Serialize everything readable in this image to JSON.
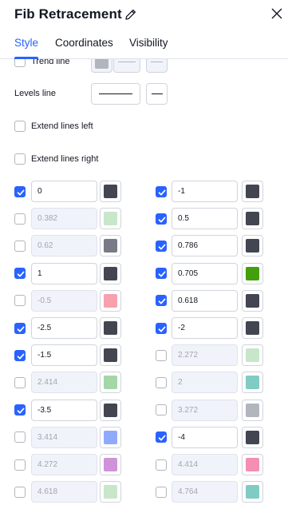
{
  "header": {
    "title": "Fib Retracement"
  },
  "tabs": [
    {
      "label": "Style",
      "active": true
    },
    {
      "label": "Coordinates",
      "active": false
    },
    {
      "label": "Visibility",
      "active": false
    }
  ],
  "trend_line": {
    "label": "Trend line",
    "checked": false
  },
  "levels_line": {
    "label": "Levels line"
  },
  "extend_left": {
    "label": "Extend lines left",
    "checked": false
  },
  "extend_right": {
    "label": "Extend lines right",
    "checked": false
  },
  "levels_left": [
    {
      "value": "0",
      "checked": true,
      "color": "#434651"
    },
    {
      "value": "0.382",
      "checked": false,
      "color": "#c8e6c9"
    },
    {
      "value": "0.62",
      "checked": false,
      "color": "#787b86"
    },
    {
      "value": "1",
      "checked": true,
      "color": "#434651"
    },
    {
      "value": "-0.5",
      "checked": false,
      "color": "#f7a1ae"
    },
    {
      "value": "-2.5",
      "checked": true,
      "color": "#434651"
    },
    {
      "value": "-1.5",
      "checked": true,
      "color": "#434651"
    },
    {
      "value": "2.414",
      "checked": false,
      "color": "#a5d6a7"
    },
    {
      "value": "-3.5",
      "checked": true,
      "color": "#434651"
    },
    {
      "value": "3.414",
      "checked": false,
      "color": "#90aafb"
    },
    {
      "value": "4.272",
      "checked": false,
      "color": "#ce93d8"
    },
    {
      "value": "4.618",
      "checked": false,
      "color": "#c8e6c9"
    }
  ],
  "levels_right": [
    {
      "value": "-1",
      "checked": true,
      "color": "#434651"
    },
    {
      "value": "0.5",
      "checked": true,
      "color": "#434651"
    },
    {
      "value": "0.786",
      "checked": true,
      "color": "#434651"
    },
    {
      "value": "0.705",
      "checked": true,
      "color": "#43a00c"
    },
    {
      "value": "0.618",
      "checked": true,
      "color": "#434651"
    },
    {
      "value": "-2",
      "checked": true,
      "color": "#434651"
    },
    {
      "value": "2.272",
      "checked": false,
      "color": "#c8e6c9"
    },
    {
      "value": "2",
      "checked": false,
      "color": "#80cbc4"
    },
    {
      "value": "3.272",
      "checked": false,
      "color": "#b2b5be"
    },
    {
      "value": "-4",
      "checked": true,
      "color": "#434651"
    },
    {
      "value": "4.414",
      "checked": false,
      "color": "#f48fb1"
    },
    {
      "value": "4.764",
      "checked": false,
      "color": "#80cbc4"
    }
  ],
  "colors": {
    "accent": "#2962ff",
    "text": "#131722",
    "border": "#d1d4dc"
  }
}
